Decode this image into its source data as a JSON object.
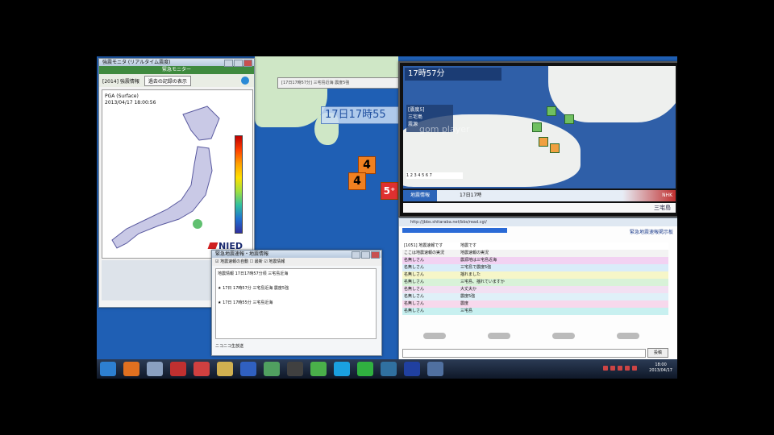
{
  "nied": {
    "title": "強震モニタ (リアルタイム震度)",
    "header": "緊急モニター",
    "tab_label": "[2014] 強震情報",
    "button_label": "過去の記録の表示",
    "map_text": "PGA (Surface)\n2013/04/17 18:00:56",
    "logo": "NIED"
  },
  "sea_map": {
    "toolbar": "[17日17時57分] 三宅島近海 震度5強",
    "time_label": "17日17時55",
    "quakes": [
      "4",
      "4",
      "5⁺"
    ]
  },
  "broadcast": {
    "header": "17時57分",
    "info": "[震度5]\n三宅島\n震源",
    "legend": "1 2 3 4 5 6 7",
    "bar_left": "地震情報",
    "bar_mid": "17日17時",
    "bar_right": "NHK",
    "ticker": "三宅島"
  },
  "chat": {
    "url": "http://jbbs.shitaraba.net/bbs/read.cgi/",
    "site": "緊急地震速報掲示板",
    "rows": [
      {
        "name": "[1051] 地震速報です",
        "text": "地震です",
        "bg": "#ffffff"
      },
      {
        "name": "ここは地震速報の実況",
        "text": "地震速報の実況",
        "bg": "#f3f3f3"
      },
      {
        "name": "名無しさん",
        "text": "震源地は三宅島近海",
        "bg": "#f2d2f2"
      },
      {
        "name": "名無しさん",
        "text": "三宅島で震度5強",
        "bg": "#d9ecf9"
      },
      {
        "name": "名無しさん",
        "text": "揺れました",
        "bg": "#f6f6c8"
      },
      {
        "name": "名無しさん",
        "text": "三宅島、揺れていますか",
        "bg": "#d8f2d8"
      },
      {
        "name": "名無しさん",
        "text": "大丈夫か",
        "bg": "#f2e0f2"
      },
      {
        "name": "名無しさん",
        "text": "震度5強",
        "bg": "#dff0f8"
      },
      {
        "name": "名無しさん",
        "text": "震度",
        "bg": "#f7d8ec"
      },
      {
        "name": "名無しさん",
        "text": "三宅島",
        "bg": "#c8f0f0"
      }
    ],
    "send_label": "投稿"
  },
  "comment": {
    "title": "緊急地震速報・地震情報",
    "options": "☑ 地震速報の自動  ☐ 最新  ☑ 地震情報",
    "body": "地震情報 17日17時57分頃 三宅島近海\n\n★ 17日 17時57分 三宅島近海 震度5強\n\n★ 17日 17時55分 三宅島近海",
    "footer": "ニコニコ生放送"
  },
  "taskbar": {
    "clock_time": "18:00",
    "clock_date": "2013/04/17",
    "icons": [
      "start-orb-icon",
      "firefox-icon",
      "app-icon",
      "tool-icon",
      "browser-icon",
      "folder-icon",
      "mail-icon",
      "photo-icon",
      "k-icon",
      "chat-icon",
      "skype-icon",
      "green-icon",
      "media-icon",
      "app2-icon",
      "app3-icon"
    ]
  },
  "watermark": "gom player"
}
